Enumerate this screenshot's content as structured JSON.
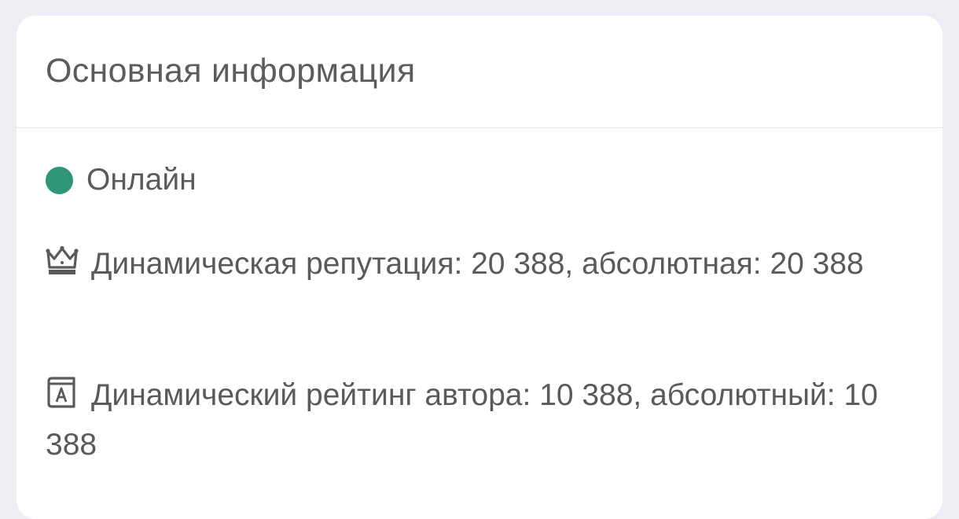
{
  "card": {
    "title": "Основная информация"
  },
  "status": {
    "label": "Онлайн",
    "color": "#2e9676"
  },
  "reputation": {
    "icon": "crown-icon",
    "text": "Динамическая репутация: 20 388, абсолютная: 20 388"
  },
  "author_rating": {
    "icon": "book-icon",
    "text": "Динамический рейтинг автора: 10 388, абсолютный: 10 388"
  }
}
